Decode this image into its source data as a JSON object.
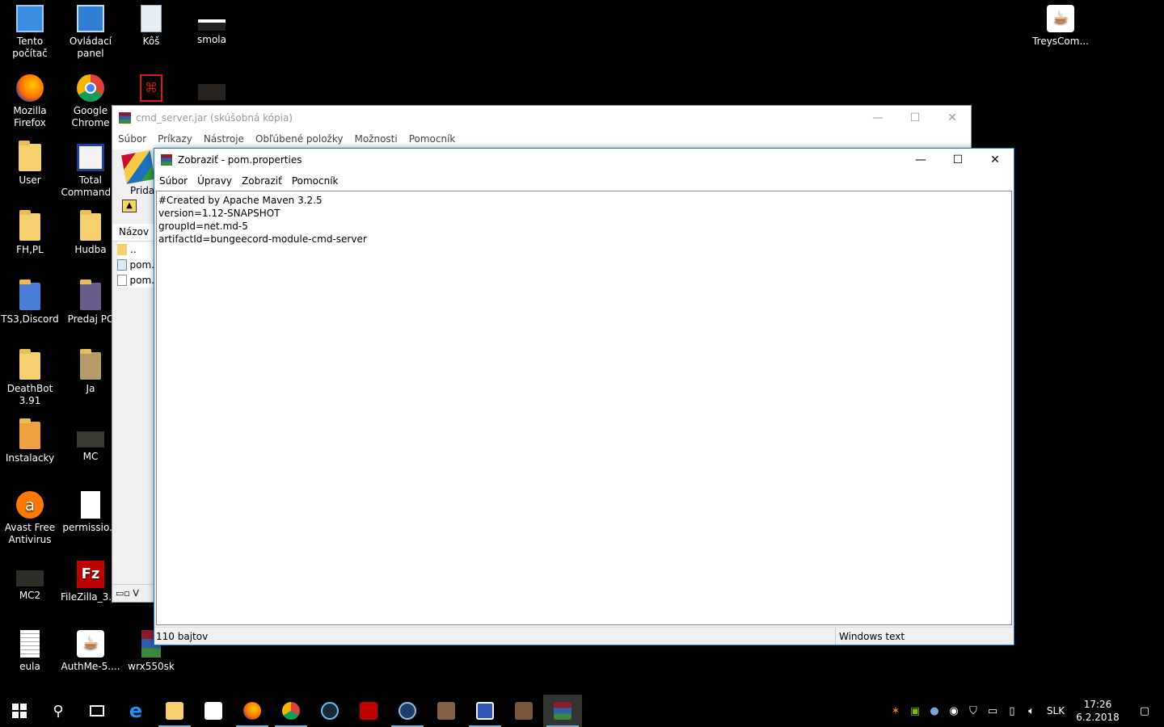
{
  "desktop": {
    "icons": [
      {
        "label": "Tento počítač"
      },
      {
        "label": "Ovládací panel"
      },
      {
        "label": "Kôš"
      },
      {
        "label": "smola"
      },
      {
        "label": "TreysCom..."
      },
      {
        "label": "Mozilla Firefox"
      },
      {
        "label": "Google Chrome"
      },
      {
        "label": "User"
      },
      {
        "label": "Total Command..."
      },
      {
        "label": "FH,PL"
      },
      {
        "label": "Hudba"
      },
      {
        "label": "TS3,Discord"
      },
      {
        "label": "Predaj PC"
      },
      {
        "label": "DeathBot 3.91"
      },
      {
        "label": "Ja"
      },
      {
        "label": "Instalacky"
      },
      {
        "label": "MC"
      },
      {
        "label": "Avast Free Antivirus"
      },
      {
        "label": "permissio..."
      },
      {
        "label": "MC2"
      },
      {
        "label": "FileZilla_3.3..."
      },
      {
        "label": "eula"
      },
      {
        "label": "AuthMe-5...."
      },
      {
        "label": "wrx550sk"
      }
    ]
  },
  "rar_window": {
    "title": "cmd_server.jar (skúšobná kópia)",
    "menu": [
      "Súbor",
      "Príkazy",
      "Nástroje",
      "Obľúbené položky",
      "Možnosti",
      "Pomocník"
    ],
    "add_label": "Pridať",
    "column_name": "Názov",
    "rows": [
      "..",
      "pom.",
      "pom."
    ],
    "status": "V"
  },
  "viewer": {
    "title": "Zobraziť - pom.properties",
    "menu": [
      "Súbor",
      "Úpravy",
      "Zobraziť",
      "Pomocník"
    ],
    "content": "#Created by Apache Maven 3.2.5\nversion=1.12-SNAPSHOT\ngroupId=net.md-5\nartifactId=bungeecord-module-cmd-server",
    "status_size": "110 bajtov",
    "status_encoding": "Windows text"
  },
  "taskbar": {
    "language": "SLK",
    "time": "17:26",
    "date": "6.2.2018"
  },
  "colors": {
    "accent": "#1979ca",
    "desktop": "#000000"
  }
}
